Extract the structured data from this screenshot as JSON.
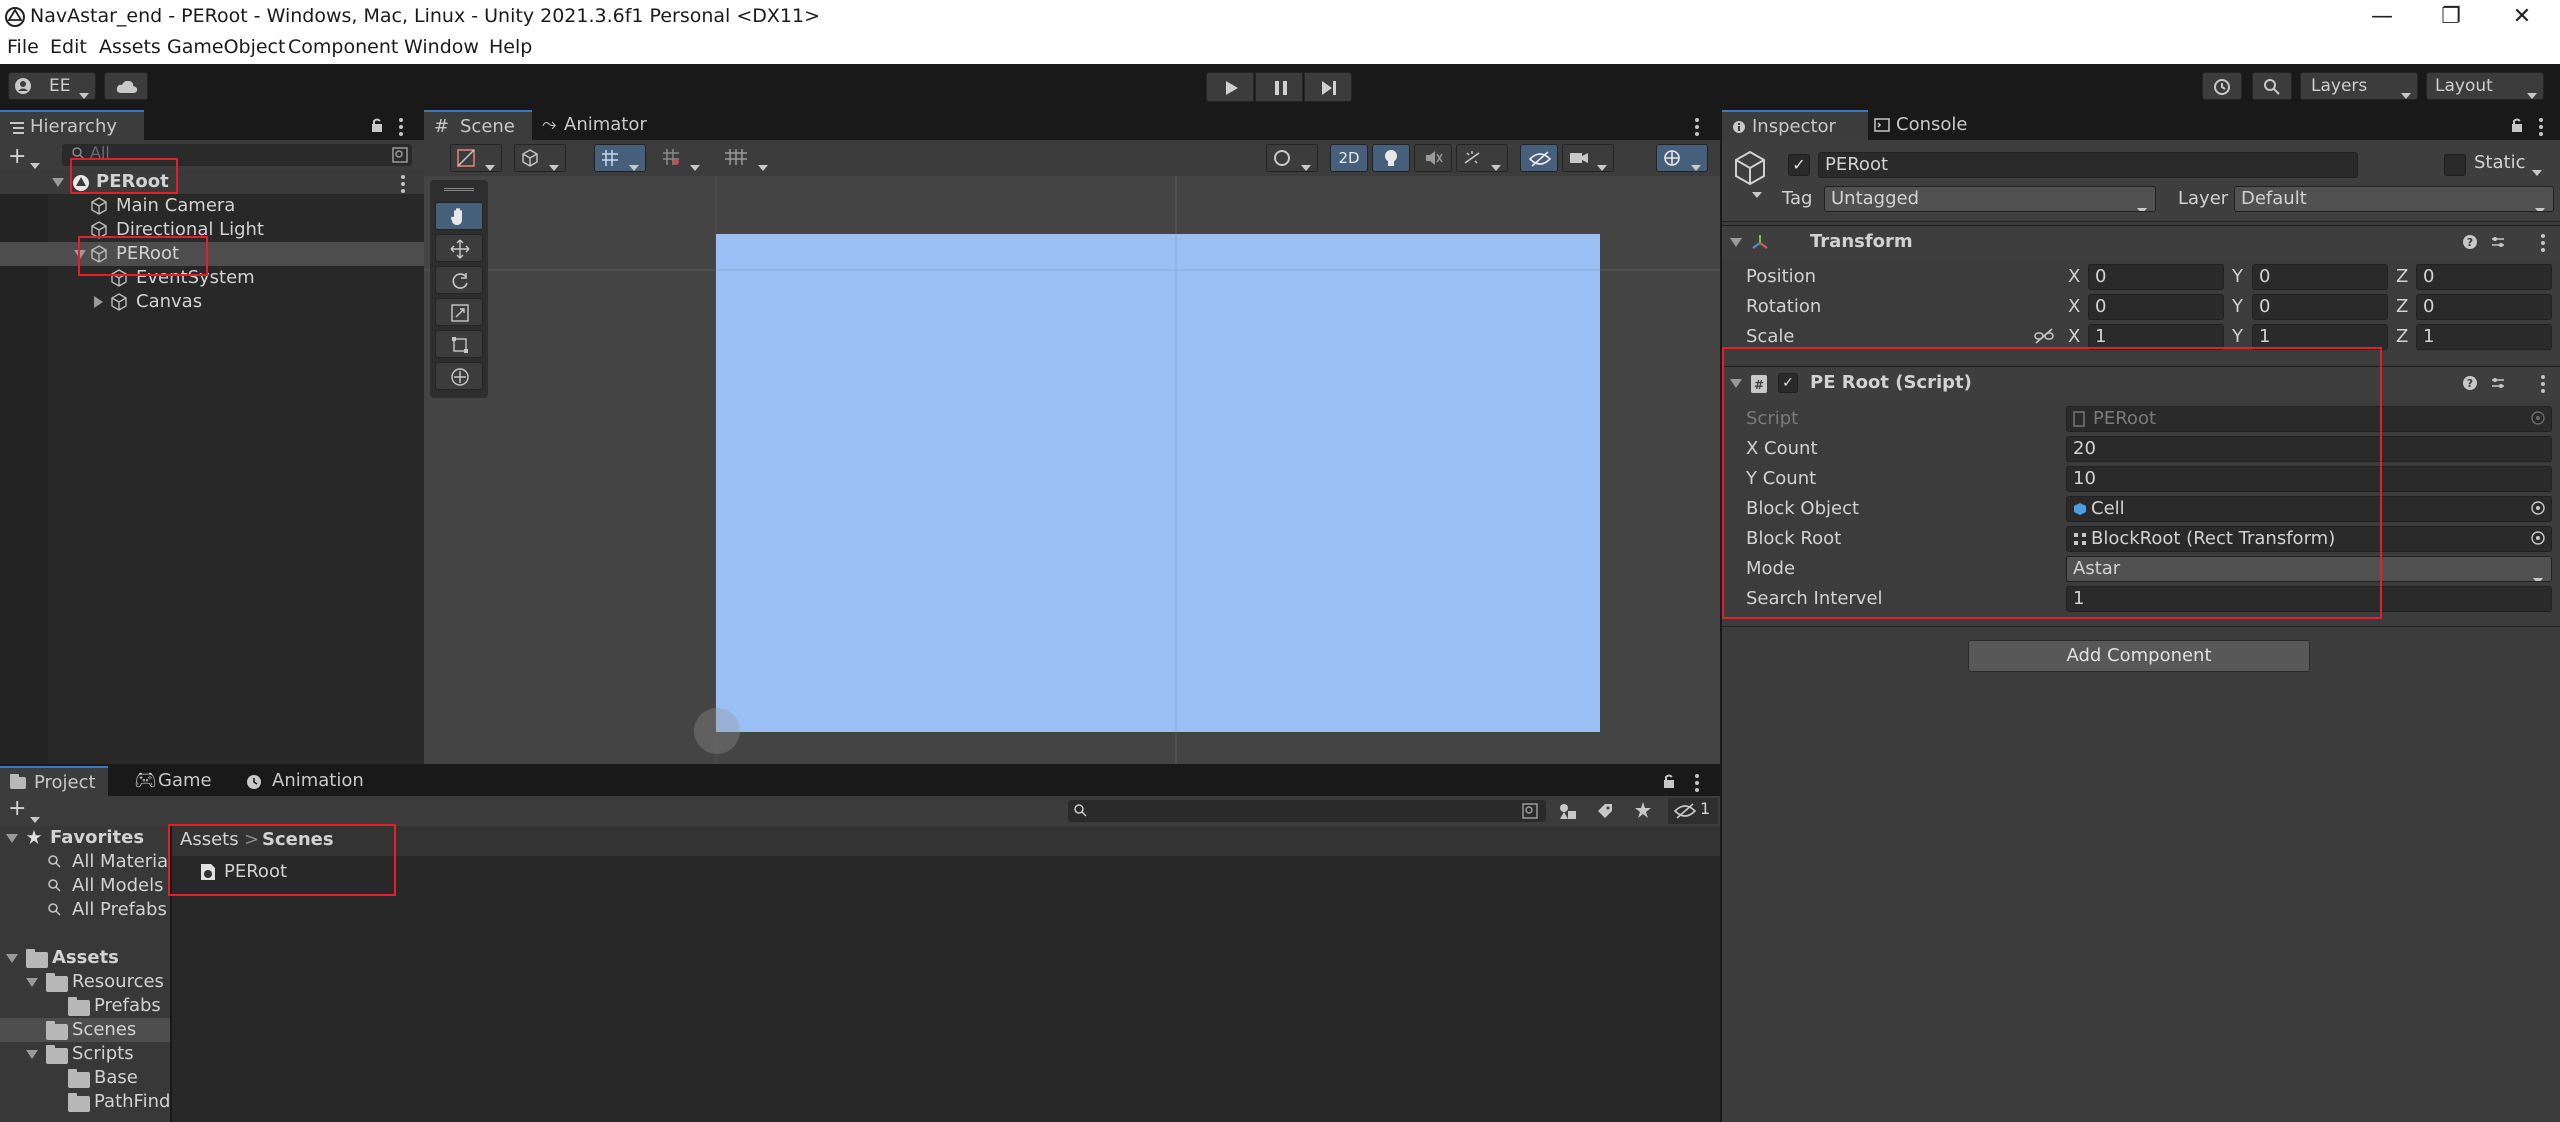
{
  "window": {
    "title": "NavAstar_end - PERoot - Windows, Mac, Linux - Unity 2021.3.6f1 Personal <DX11>",
    "minimize": "—",
    "restore": "❐",
    "close": "✕"
  },
  "menu": [
    "File",
    "Edit",
    "Assets",
    "GameObject",
    "Component",
    "Window",
    "Help"
  ],
  "toolbar": {
    "account": "EE",
    "layers": "Layers",
    "layout": "Layout"
  },
  "hierarchy": {
    "tab": "Hierarchy",
    "search_placeholder": "All",
    "scene_name": "PERoot",
    "items": [
      {
        "label": "Main Camera"
      },
      {
        "label": "Directional Light"
      },
      {
        "label": "PERoot"
      },
      {
        "label": "EventSystem"
      },
      {
        "label": "Canvas"
      }
    ]
  },
  "scene": {
    "tabs": [
      "Scene",
      "Animator"
    ],
    "toggle_2d": "2D",
    "canvas_color": "#99bff5"
  },
  "inspector": {
    "tabs": [
      "Inspector",
      "Console"
    ],
    "object_name": "PERoot",
    "static_label": "Static",
    "tag_label": "Tag",
    "tag_value": "Untagged",
    "layer_label": "Layer",
    "layer_value": "Default",
    "transform": {
      "title": "Transform",
      "position": {
        "label": "Position",
        "x": "0",
        "y": "0",
        "z": "0"
      },
      "rotation": {
        "label": "Rotation",
        "x": "0",
        "y": "0",
        "z": "0"
      },
      "scale": {
        "label": "Scale",
        "x": "1",
        "y": "1",
        "z": "1"
      }
    },
    "script_component": {
      "title": "PE Root (Script)",
      "script_label": "Script",
      "script_value": "PERoot",
      "x_count_label": "X Count",
      "x_count": "20",
      "y_count_label": "Y Count",
      "y_count": "10",
      "block_object_label": "Block Object",
      "block_object": "Cell",
      "block_root_label": "Block Root",
      "block_root": "BlockRoot (Rect Transform)",
      "mode_label": "Mode",
      "mode": "Astar",
      "search_interval_label": "Search Intervel",
      "search_interval": "1"
    },
    "add_component": "Add Component"
  },
  "project": {
    "tabs": [
      "Project",
      "Game",
      "Animation"
    ],
    "hidden_count": "1",
    "favorites": {
      "label": "Favorites",
      "items": [
        "All Material",
        "All Models",
        "All Prefabs"
      ]
    },
    "assets": {
      "label": "Assets",
      "resources": "Resources",
      "prefabs": "Prefabs",
      "scenes": "Scenes",
      "scripts": "Scripts",
      "base": "Base",
      "pathfind": "PathFind"
    },
    "breadcrumb": [
      "Assets",
      "Scenes"
    ],
    "breadcrumb_sep": ">",
    "files": [
      "PERoot"
    ]
  },
  "colors": {
    "highlight_red": "#e0202a",
    "accent_blue": "#3a79bb"
  }
}
